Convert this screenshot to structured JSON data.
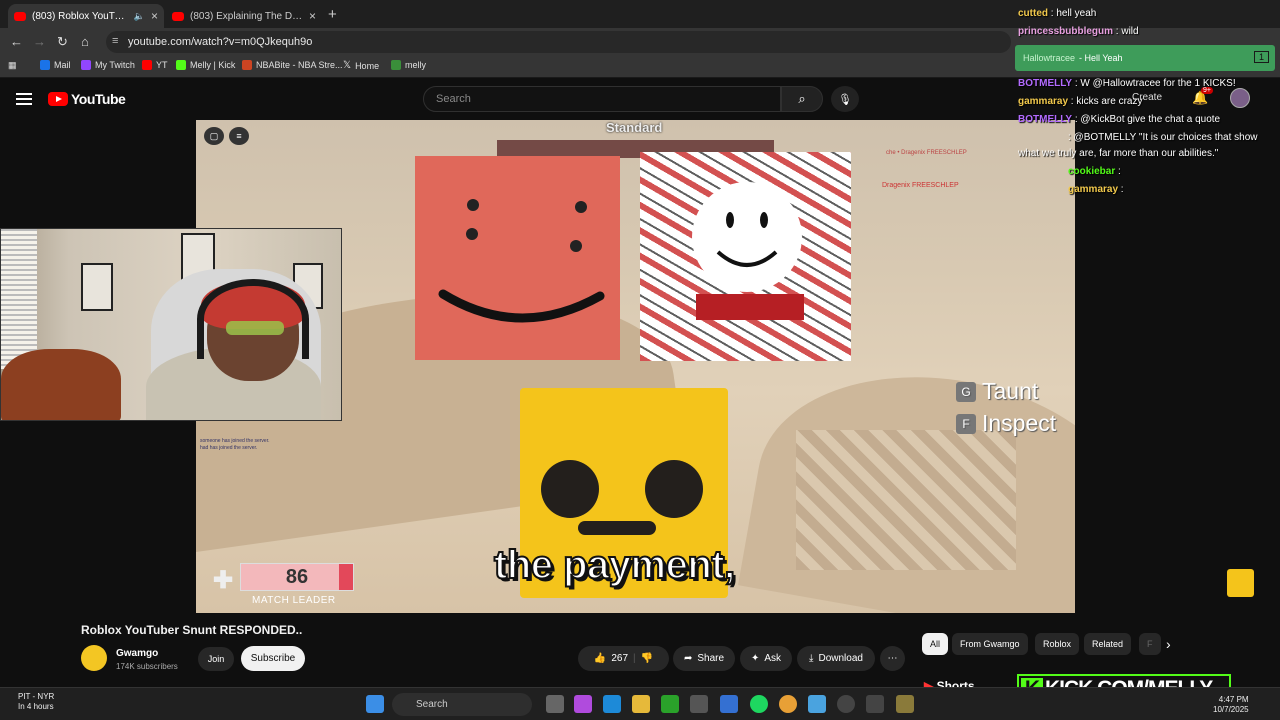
{
  "browser": {
    "tabs": [
      {
        "label": "(803) Roblox YouTuber Snunt",
        "active": true
      },
      {
        "label": "(803) Explaining The Drama (D",
        "active": false
      }
    ],
    "url": "youtube.com/watch?v=m0QJkequh9o",
    "bookmarks": [
      "Mail",
      "My Twitch",
      "YT",
      "Melly | Kick",
      "NBABite - NBA Stre...",
      "Home",
      "melly"
    ]
  },
  "youtube": {
    "logo": "YouTube",
    "search_placeholder": "Search",
    "create_label": "Create",
    "notif_count": "9+"
  },
  "video": {
    "mode_label": "Standard",
    "killfeed": "che • Dragenix FREESCHLEP",
    "killfeed2": "Dragenix FREESCHLEP",
    "caption": "the payment,",
    "taunt_key": "G",
    "taunt_label": "Taunt",
    "inspect_key": "F",
    "inspect_label": "Inspect",
    "score": "86",
    "score_label": "MATCH LEADER",
    "join_msg_1": "someone has joined the server.",
    "join_msg_2": "had has joined the server."
  },
  "chat": {
    "messages": [
      {
        "user": "cutted",
        "text": " : hell yeah",
        "color": "#f2c94c"
      },
      {
        "user": "princessbubblegum",
        "text": " : wild",
        "color": "#e8a0e0"
      },
      {
        "user": "BOTMELLY",
        "text": " : W @Hallowtracee for the 1 KICKS!",
        "color": "#b36bff"
      },
      {
        "user": "gammaray",
        "text": " : kicks are crazy",
        "color": "#f2c94c"
      },
      {
        "user": "BOTMELLY",
        "text": " : @KickBot give the chat a quote",
        "color": "#b36bff"
      },
      {
        "user": "",
        "text": " : @BOTMELLY \"It is our choices that show",
        "color": "#53fc18"
      },
      {
        "user": "",
        "text": "what we truly are, far more than our abilities.\"",
        "color": "#fff"
      },
      {
        "user": "cookiebar",
        "text": " :",
        "color": "#53fc18"
      },
      {
        "user": "gammaray",
        "text": " :",
        "color": "#f2c94c"
      }
    ],
    "pinned_user": "Hallowtracee",
    "pinned_text": "- Hell Yeah",
    "pinned_count": "1"
  },
  "meta": {
    "title": "Roblox YouTuber Snunt RESPONDED..",
    "channel": "Gwamgo",
    "subs": "174K subscribers",
    "join": "Join",
    "subscribe": "Subscribe",
    "likes": "267",
    "share": "Share",
    "ask": "Ask",
    "download": "Download",
    "more": "⋯"
  },
  "chips": [
    "All",
    "From Gwamgo",
    "Roblox",
    "Related",
    "F"
  ],
  "shorts": "Shorts",
  "kick": "KICK.COM/MELLY",
  "taskbar": {
    "weather_title": "PIT - NYR",
    "weather_sub": "In 4 hours",
    "search": "Search",
    "time": "4:47 PM",
    "date": "10/7/2025"
  },
  "colors": {
    "youtube_red": "#ff0000",
    "kick_green": "#53fc18"
  }
}
